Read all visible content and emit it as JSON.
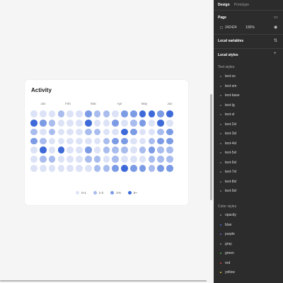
{
  "card": {
    "title": "Activity",
    "months": [
      "Jan",
      "Feb",
      "Mar",
      "Apr",
      "May",
      "Jun"
    ]
  },
  "chart_data": {
    "type": "heatmap",
    "title": "Activity",
    "x_categories": [
      "Jan",
      "Feb",
      "Mar",
      "Apr",
      "May",
      "Jun"
    ],
    "legend": [
      "0-1",
      "1-2",
      "2-5",
      "5+"
    ],
    "levels_colors": [
      "#dde3f7",
      "#a9bcee",
      "#7c9be5",
      "#3e6ad9"
    ],
    "weeks_per_row": 16,
    "values": [
      [
        0,
        0,
        0,
        1,
        0,
        0,
        2,
        1,
        1,
        0,
        2,
        2,
        3,
        3,
        2,
        3
      ],
      [
        3,
        2,
        1,
        0,
        0,
        0,
        3,
        0,
        0,
        2,
        0,
        1,
        2,
        0,
        3,
        0
      ],
      [
        1,
        0,
        1,
        0,
        0,
        0,
        1,
        1,
        0,
        0,
        3,
        2,
        0,
        0,
        1,
        2
      ],
      [
        2,
        1,
        0,
        0,
        0,
        0,
        0,
        0,
        1,
        2,
        2,
        0,
        0,
        1,
        2,
        2
      ],
      [
        0,
        3,
        0,
        3,
        0,
        0,
        2,
        0,
        1,
        1,
        1,
        0,
        1,
        2,
        1,
        1
      ],
      [
        0,
        1,
        1,
        0,
        0,
        0,
        1,
        1,
        0,
        1,
        0,
        0,
        0,
        1,
        1,
        1
      ],
      [
        0,
        0,
        0,
        0,
        0,
        0,
        0,
        1,
        1,
        2,
        3,
        2,
        2,
        1,
        2,
        2
      ]
    ]
  },
  "panel": {
    "tabs": [
      "Design",
      "Prototype"
    ],
    "page_label": "Page",
    "page_color": "242424",
    "page_opacity": "100%",
    "local_variables": "Local variables",
    "local_styles": "Local styles",
    "text_styles_label": "Text styles",
    "text_styles": [
      "text-xs",
      "text-sm",
      "text-base",
      "text-lg",
      "text-xl",
      "text-2xl",
      "text-3xl",
      "text-4xl",
      "text-5xl",
      "text-6xl",
      "text-7xl",
      "text-8xl",
      "text-9xl"
    ],
    "color_styles_label": "Color styles",
    "color_styles": [
      {
        "name": "opacity",
        "color": "#8a8a8a"
      },
      {
        "name": "blue",
        "color": "#3e6ad9"
      },
      {
        "name": "purple",
        "color": "#8a5cd6"
      },
      {
        "name": "gray",
        "color": "#8a8a8a"
      },
      {
        "name": "green",
        "color": "#4caf50"
      },
      {
        "name": "red",
        "color": "#e04545"
      },
      {
        "name": "yellow",
        "color": "#e6c140"
      }
    ]
  }
}
